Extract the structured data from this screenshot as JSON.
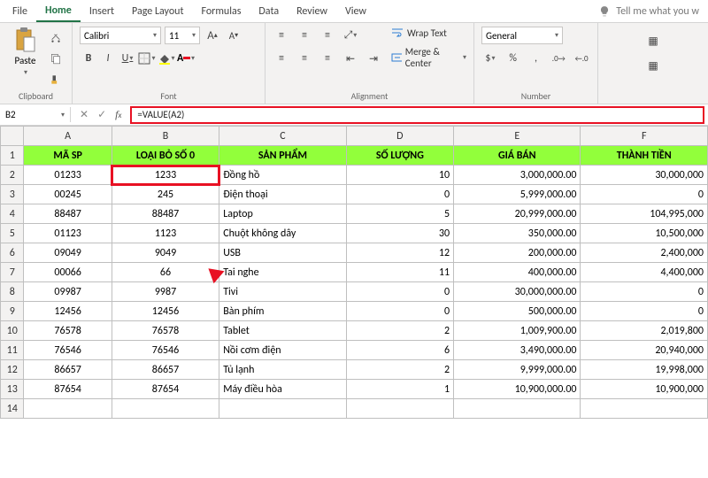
{
  "tabs": {
    "file": "File",
    "home": "Home",
    "insert": "Insert",
    "pagelayout": "Page Layout",
    "formulas": "Formulas",
    "data": "Data",
    "review": "Review",
    "view": "View",
    "tellme": "Tell me what you w"
  },
  "ribbon": {
    "paste": "Paste",
    "clipboard": "Clipboard",
    "font_group": "Font",
    "alignment": "Alignment",
    "number": "Number",
    "font_name": "Calibri",
    "font_size": "11",
    "wrap": "Wrap Text",
    "merge": "Merge & Center",
    "num_format": "General",
    "decrease_font": "A",
    "increase_font": "A"
  },
  "fx": {
    "cellref": "B2",
    "formula": "=VALUE(A2)"
  },
  "cols": [
    "A",
    "B",
    "C",
    "D",
    "E",
    "F"
  ],
  "headers": {
    "a": "MÃ SP",
    "b": "LOẠI BỎ SỐ 0",
    "c": "SẢN PHẨM",
    "d": "SỐ LƯỢNG",
    "e": "GIÁ BÁN",
    "f": "THÀNH TIỀN"
  },
  "rows": [
    {
      "n": "2",
      "a": "01233",
      "b": "1233",
      "c": "Đồng hồ",
      "d": "10",
      "e": "3,000,000.00",
      "f": "30,000,000"
    },
    {
      "n": "3",
      "a": "00245",
      "b": "245",
      "c": "Điện thoại",
      "d": "0",
      "e": "5,999,000.00",
      "f": "0"
    },
    {
      "n": "4",
      "a": "88487",
      "b": "88487",
      "c": "Laptop",
      "d": "5",
      "e": "20,999,000.00",
      "f": "104,995,000"
    },
    {
      "n": "5",
      "a": "01123",
      "b": "1123",
      "c": "Chuột không dây",
      "d": "30",
      "e": "350,000.00",
      "f": "10,500,000"
    },
    {
      "n": "6",
      "a": "09049",
      "b": "9049",
      "c": "USB",
      "d": "12",
      "e": "200,000.00",
      "f": "2,400,000"
    },
    {
      "n": "7",
      "a": "00066",
      "b": "66",
      "c": "Tai nghe",
      "d": "11",
      "e": "400,000.00",
      "f": "4,400,000"
    },
    {
      "n": "8",
      "a": "09987",
      "b": "9987",
      "c": "Tivi",
      "d": "0",
      "e": "30,000,000.00",
      "f": "0"
    },
    {
      "n": "9",
      "a": "12456",
      "b": "12456",
      "c": "Bàn phím",
      "d": "0",
      "e": "500,000.00",
      "f": "0"
    },
    {
      "n": "10",
      "a": "76578",
      "b": "76578",
      "c": "Tablet",
      "d": "2",
      "e": "1,009,900.00",
      "f": "2,019,800"
    },
    {
      "n": "11",
      "a": "76546",
      "b": "76546",
      "c": "Nồi cơm điện",
      "d": "6",
      "e": "3,490,000.00",
      "f": "20,940,000"
    },
    {
      "n": "12",
      "a": "86657",
      "b": "86657",
      "c": "Tủ lạnh",
      "d": "2",
      "e": "9,999,000.00",
      "f": "19,998,000"
    },
    {
      "n": "13",
      "a": "87654",
      "b": "87654",
      "c": "Máy điều hòa",
      "d": "1",
      "e": "10,900,000.00",
      "f": "10,900,000"
    },
    {
      "n": "14",
      "a": "",
      "b": "",
      "c": "",
      "d": "",
      "e": "",
      "f": ""
    }
  ]
}
